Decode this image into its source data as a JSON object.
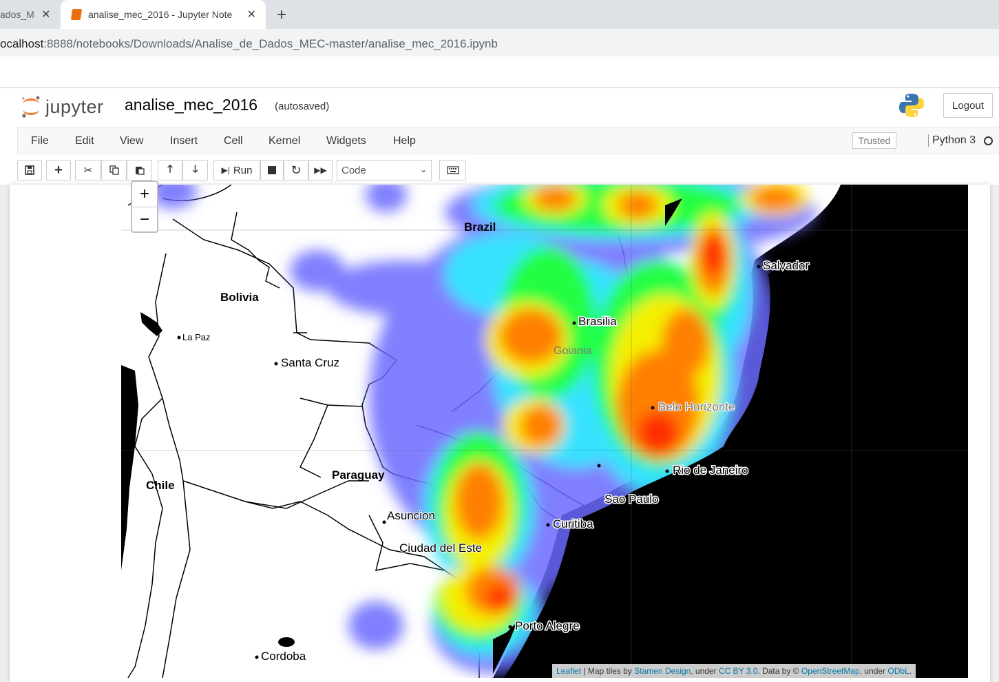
{
  "browser": {
    "tabs": [
      {
        "title": "ados_M"
      },
      {
        "title": "analise_mec_2016 - Jupyter Note"
      }
    ],
    "new_tab": "+",
    "url_host": "ocalhost",
    "url_path": ":8888/notebooks/Downloads/Analise_de_Dados_MEC-master/analise_mec_2016.ipynb"
  },
  "jupyter": {
    "logo_text": "jupyter",
    "notebook_name": "analise_mec_2016",
    "autosave_status": "(autosaved)",
    "logout_label": "Logout",
    "menu": [
      "File",
      "Edit",
      "View",
      "Insert",
      "Cell",
      "Kernel",
      "Widgets",
      "Help"
    ],
    "trusted_label": "Trusted",
    "kernel_name": "Python 3",
    "run_label": "Run",
    "cell_type": "Code"
  },
  "map": {
    "zoom_in": "+",
    "zoom_out": "−",
    "country_labels": [
      "Brazil",
      "Bolivia",
      "Paraguay",
      "Chile"
    ],
    "city_labels": [
      "Salvador",
      "Brasilia",
      "Goiania",
      "Belo Horizonte",
      "Rio de Janeiro",
      "Sao Paulo",
      "Curitiba",
      "Porto Alegre",
      "La Paz",
      "Santa Cruz",
      "Asuncion",
      "Ciudad del Este",
      "Cordoba"
    ],
    "attribution": {
      "leaflet": "Leaflet",
      "sep1": " | Map tiles by ",
      "stamen": "Stamen Design",
      "sep2": ", under ",
      "ccby": "CC BY 3.0",
      "sep3": ". Data by © ",
      "osm": "OpenStreetMap",
      "sep4": ", under ",
      "odbl": "ODbL",
      "end": "."
    },
    "heat_colors": {
      "low": "#5b5bff",
      "mid1": "#35e8ff",
      "mid2": "#00ff44",
      "mid3": "#ffff00",
      "high": "#ff8800",
      "peak": "#ff2200"
    },
    "ocean_color": "#000000"
  }
}
